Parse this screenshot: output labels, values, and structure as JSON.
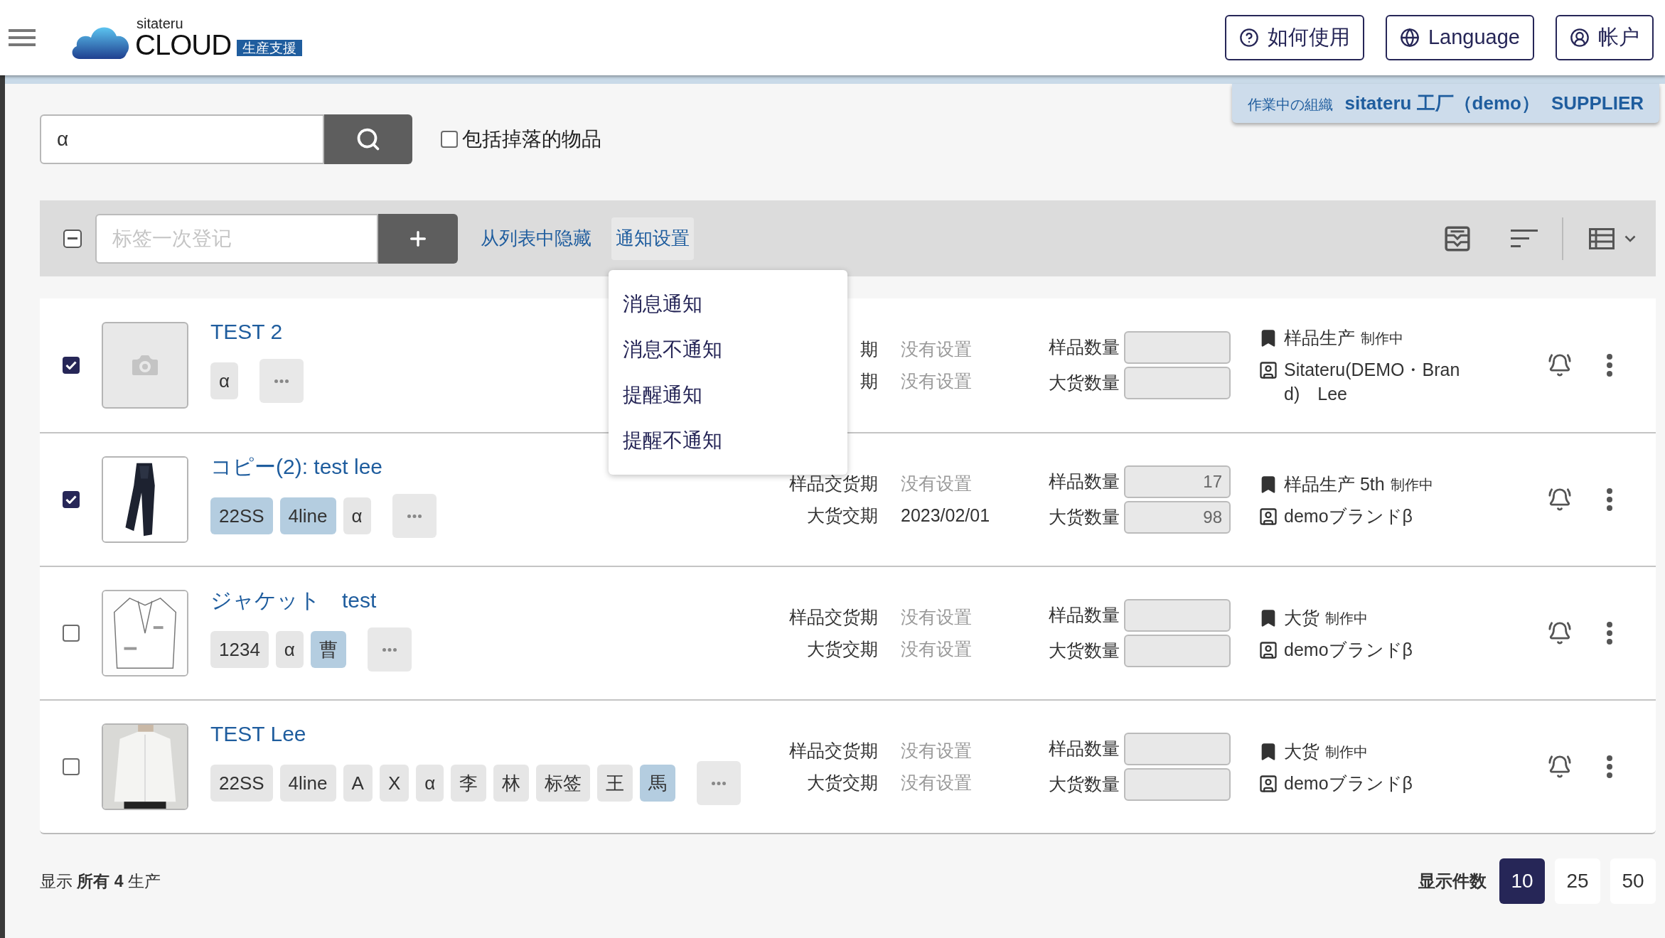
{
  "header": {
    "logo": {
      "small": "sitateru",
      "main": "CLOUD",
      "badge": "生産支援"
    },
    "buttons": [
      {
        "kind": "help",
        "label": "如何使用"
      },
      {
        "kind": "language",
        "label": "Language"
      },
      {
        "kind": "account",
        "label": "帐户"
      }
    ]
  },
  "org": {
    "label": "作業中の組織",
    "name": "sitateru 工厂（demo）",
    "role": "SUPPLIER"
  },
  "search": {
    "value": "α",
    "include_dropped": {
      "label": "包括掉落的物品",
      "checked": false
    }
  },
  "toolbar": {
    "select_all_indeterminate": true,
    "tag_placeholder": "标签一次登记",
    "hide_link": "从列表中隐藏",
    "notify": {
      "label": "通知设置",
      "open": true,
      "items": [
        "消息通知",
        "消息不通知",
        "提醒通知",
        "提醒不通知"
      ]
    }
  },
  "rows": [
    {
      "selected": true,
      "image": {
        "kind": "placeholder"
      },
      "title": "TEST 2",
      "tags": [
        {
          "label": "α",
          "color": "#e6e6e6"
        }
      ],
      "sample_date_label": "期",
      "sample_date": "没有设置",
      "bulk_date_label": "期",
      "bulk_date": "没有设置",
      "sample_qty_label": "样品数量",
      "sample_qty": "",
      "bulk_qty_label": "大货数量",
      "bulk_qty": "",
      "stage": "样品生产",
      "status": "制作中",
      "brand": "Sitateru(DEMO・Brand)　Lee"
    },
    {
      "selected": true,
      "image": {
        "kind": "picture"
      },
      "title": "コピー(2): test lee",
      "tags": [
        {
          "label": "22SS",
          "color": "#b4cde0"
        },
        {
          "label": "4line",
          "color": "#b4cde0"
        },
        {
          "label": "α",
          "color": "#e6e6e6"
        }
      ],
      "sample_date_label": "样品交货期",
      "sample_date": "没有设置",
      "bulk_date_label": "大货交期",
      "bulk_date": "2023/02/01",
      "sample_qty_label": "样品数量",
      "sample_qty": "17",
      "bulk_qty_label": "大货数量",
      "bulk_qty": "98",
      "stage": "样品生产 5th",
      "status": "制作中",
      "brand": "demoブランドβ"
    },
    {
      "selected": false,
      "image": {
        "kind": "picture"
      },
      "title": "ジャケット　test",
      "tags": [
        {
          "label": "1234",
          "color": "#e6e6e6"
        },
        {
          "label": "α",
          "color": "#e6e6e6"
        },
        {
          "label": "曹",
          "color": "#b4cde0"
        }
      ],
      "sample_date_label": "样品交货期",
      "sample_date": "没有设置",
      "bulk_date_label": "大货交期",
      "bulk_date": "没有设置",
      "sample_qty_label": "样品数量",
      "sample_qty": "",
      "bulk_qty_label": "大货数量",
      "bulk_qty": "",
      "stage": "大货",
      "status": "制作中",
      "brand": "demoブランドβ"
    },
    {
      "selected": false,
      "image": {
        "kind": "picture"
      },
      "title": "TEST Lee",
      "tags": [
        {
          "label": "22SS",
          "color": "#e6e6e6"
        },
        {
          "label": "4line",
          "color": "#e6e6e6"
        },
        {
          "label": "A",
          "color": "#e6e6e6"
        },
        {
          "label": "X",
          "color": "#e6e6e6"
        },
        {
          "label": "α",
          "color": "#e6e6e6"
        },
        {
          "label": "李",
          "color": "#e6e6e6"
        },
        {
          "label": "林",
          "color": "#e6e6e6"
        },
        {
          "label": "标签",
          "color": "#e6e6e6"
        },
        {
          "label": "王",
          "color": "#e6e6e6"
        },
        {
          "label": "馬",
          "color": "#b4cde0"
        }
      ],
      "sample_date_label": "样品交货期",
      "sample_date": "没有设置",
      "bulk_date_label": "大货交期",
      "bulk_date": "没有设置",
      "sample_qty_label": "样品数量",
      "sample_qty": "",
      "bulk_qty_label": "大货数量",
      "bulk_qty": "",
      "stage": "大货",
      "status": "制作中",
      "brand": "demoブランドβ"
    }
  ],
  "footer": {
    "summary": "显示 **所有 4** 生产",
    "page_size_label": "显示件数",
    "page_sizes": [
      {
        "label": "10",
        "selected": true
      },
      {
        "label": "25",
        "selected": false
      },
      {
        "label": "50",
        "selected": false
      }
    ]
  }
}
